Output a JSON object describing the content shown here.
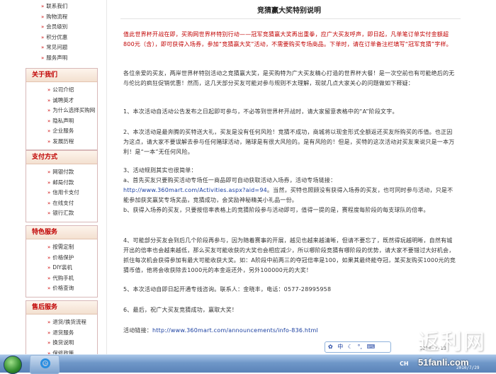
{
  "sidebar": {
    "top_items": [
      "联系我们",
      "购物流程",
      "会员级别",
      "积分优惠",
      "常见问题",
      "服务声明"
    ],
    "sections": [
      {
        "title": "关于我们",
        "items": [
          "公司介绍",
          "诚聘英才",
          "为什么选择买购网",
          "隐私声明",
          "企业服务",
          "发展历程"
        ]
      },
      {
        "title": "支付方式",
        "items": [
          "网银付款",
          "邮局付款",
          "信用卡支付",
          "在线支付",
          "银行汇款"
        ]
      },
      {
        "title": "特色服务",
        "items": [
          "按需定制",
          "价格保护",
          "DIY装机",
          "代购手机",
          "价格查询"
        ]
      },
      {
        "title": "售后服务",
        "items": [
          "退货/换货流程",
          "退货服务",
          "换货说明",
          "保修政策"
        ]
      }
    ]
  },
  "article": {
    "title": "竞猜赢大奖特别说明",
    "p1": "值此世界杯开战在即，买购网世界杯特别行动——冠军竞猜赢大奖再出重拳，应广大买友呼声，即日起，凡单笔订单实付金额超800元（含），即可获得入场券，参加“竞猜赢大奖”活动，不需要购买专场商品。下单时，请在订单备注栏填写“冠军竞猜”字样。",
    "p2": "各位亲爱的买友，两岸世界杯特别活动之竞猜赢大奖，是买购特为广大买友精心打造的世界杯大餐！是一次空前也有可能绝后的无与伦比的疯狂促销优惠！然而，这几天部分买友可能对参与规则不太理解，现就几点大家关心的问题做如下释疑：",
    "p3": "1、本次活动自活动公告发布之日起即可参与，不必等到世界杯开战时，请大家留意表格中的“A”阶段文字。",
    "p4": "2、本次活动是最奔腾的买特送大礼，买友是没有任何风险！竞猜不成功，商城将以现金形式全额返还买友所购买的币值。也正因为这点，请大家不要误解去参与任何赌球活动，赌球是有很大风险的。是有风险的！但是，买特的这次活动对买友来说只是一本万利！是“一本”无任何风险。",
    "p5_title": "3、活动规则其实也很简单：",
    "p5a": "a、首先买友只要购买活动专场任一商品即可自动获取活动入场券，活动专场链接：",
    "p5_link": "http://www.360mart.com/Activities.aspx?aid=94",
    "p5b": "。当然，买特也照顾没有获得入场券的买友，也可同时参与活动，只是不能参加获奖赢奖专场奖品，竞猜成功，会奖励神秘精美小礼品一份。",
    "p5c": "b、获得入场券的买友，只要按倍率表格上的竞猜阶段参与活动即可，值得一提的是，赛程度每阶段的每支球队的倍率。",
    "p6": "4、可能部分买友会到后几个阶段再参与，因为随着赛事的开展，越见也越来越清晰，但请不要忘了，既然得玩越明晰，自然有城开出的倍率也会越来越低，那么买友可能收获的大奖也会相应减少，所以哪阶段竞猜有哪阶段的优势，请大家不要错过大好机会，抓住每次机会获得参加有最大可能收获大奖。如：A阶段中前两三的夺冠倍率是100，如果其最终能夺冠，某买友购买1000元的竞猜币值，他将会收获除去1000元的本金返还外，另外100000元的大奖！",
    "p7": "5、本次活动自即日起开通专线咨询。联系人：金晓丰，电话：0577-28995958",
    "p8": "6、最后，祝广大买友竞猜成功，赢取大奖！",
    "p9_label": "活动链接：",
    "p9_link": "http://www.360mart.com/announcements/info-836.html"
  },
  "taskbar": {
    "lang": "CH",
    "clock_time": "2010-7-13"
  },
  "ime": {
    "label": "中"
  },
  "watermark": {
    "text": "返利网",
    "site": "51fanli.com",
    "date": "2010/7/29"
  }
}
